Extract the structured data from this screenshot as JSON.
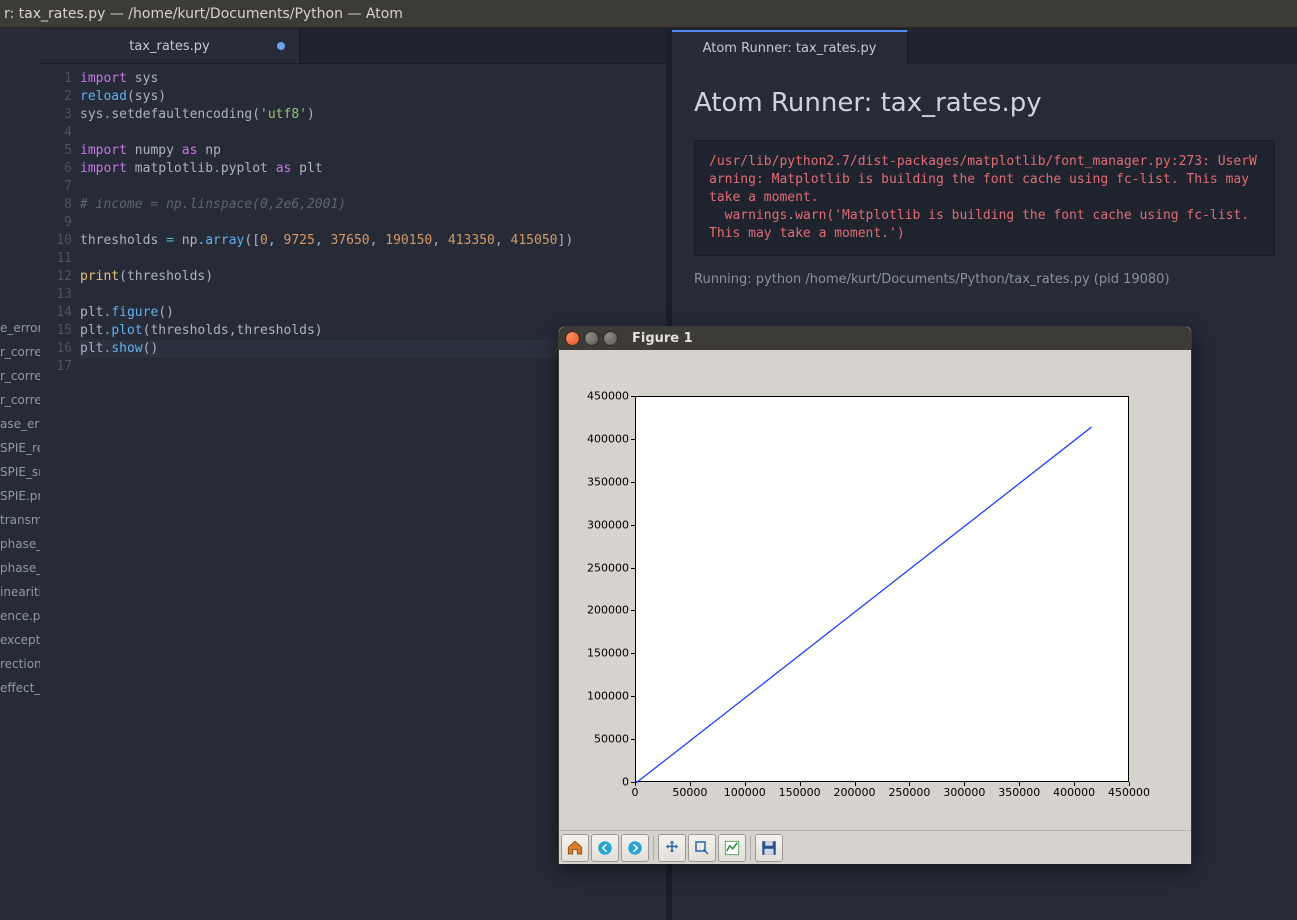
{
  "window_title": "r: tax_rates.py — /home/kurt/Documents/Python — Atom",
  "editor": {
    "tab_label": "tax_rates.py",
    "line_count": 17,
    "code_tokens": [
      [
        [
          "kw",
          "import"
        ],
        [
          "id",
          " sys"
        ]
      ],
      [
        [
          "fn",
          "reload"
        ],
        [
          "id",
          "(sys)"
        ]
      ],
      [
        [
          "id",
          "sys"
        ],
        [
          "op",
          "."
        ],
        [
          "id",
          "setdefaultencoding("
        ],
        [
          "str",
          "'utf8'"
        ],
        [
          "id",
          ")"
        ]
      ],
      [],
      [
        [
          "kw",
          "import"
        ],
        [
          "id",
          " numpy "
        ],
        [
          "kw",
          "as"
        ],
        [
          "id",
          " np"
        ]
      ],
      [
        [
          "kw",
          "import"
        ],
        [
          "id",
          " matplotlib"
        ],
        [
          "op",
          "."
        ],
        [
          "id",
          "pyplot "
        ],
        [
          "kw",
          "as"
        ],
        [
          "id",
          " plt"
        ]
      ],
      [],
      [
        [
          "cmt",
          "# income = np.linspace(0,2e6,2001)"
        ]
      ],
      [],
      [
        [
          "id",
          "thresholds "
        ],
        [
          "op",
          "="
        ],
        [
          "id",
          " np"
        ],
        [
          "op",
          "."
        ],
        [
          "fn",
          "array"
        ],
        [
          "id",
          "(["
        ],
        [
          "num",
          "0"
        ],
        [
          "id",
          ", "
        ],
        [
          "num",
          "9725"
        ],
        [
          "id",
          ", "
        ],
        [
          "num",
          "37650"
        ],
        [
          "id",
          ", "
        ],
        [
          "num",
          "190150"
        ],
        [
          "id",
          ", "
        ],
        [
          "num",
          "413350"
        ],
        [
          "id",
          ", "
        ],
        [
          "num",
          "415050"
        ],
        [
          "id",
          "])"
        ]
      ],
      [],
      [
        [
          "bi",
          "print"
        ],
        [
          "id",
          "(thresholds)"
        ]
      ],
      [],
      [
        [
          "id",
          "plt"
        ],
        [
          "op",
          "."
        ],
        [
          "fn",
          "figure"
        ],
        [
          "id",
          "()"
        ]
      ],
      [
        [
          "id",
          "plt"
        ],
        [
          "op",
          "."
        ],
        [
          "fn",
          "plot"
        ],
        [
          "id",
          "(thresholds,thresholds)"
        ]
      ],
      [
        [
          "id",
          "plt"
        ],
        [
          "op",
          "."
        ],
        [
          "fn",
          "show"
        ],
        [
          "id",
          "()"
        ]
      ],
      []
    ],
    "highlight_line": 16
  },
  "tree_items": [
    "e_error:",
    "r_corre",
    "r_corre",
    "r_corre",
    "ase_err",
    "SPIE_re",
    "SPIE_sr",
    "SPIE.pr",
    "transm",
    "phase_",
    "phase_",
    "inearitie",
    "ence.py",
    "except",
    "rection_",
    "effect_"
  ],
  "runner": {
    "tab_label": "Atom Runner: tax_rates.py",
    "heading": "Atom Runner: tax_rates.py",
    "output": "/usr/lib/python2.7/dist-packages/matplotlib/font_manager.py:273: UserWarning: Matplotlib is building the font cache using fc-list. This may take a moment.\n  warnings.warn('Matplotlib is building the font cache using fc-list. This may take a moment.')",
    "status": "Running: python /home/kurt/Documents/Python/tax_rates.py (pid 19080)"
  },
  "figure": {
    "title": "Figure 1",
    "toolbar": [
      "home",
      "back",
      "forward",
      "pan",
      "zoom",
      "subplots",
      "save"
    ]
  },
  "chart_data": {
    "type": "line",
    "x": [
      0,
      9725,
      37650,
      190150,
      413350,
      415050
    ],
    "y": [
      0,
      9725,
      37650,
      190150,
      413350,
      415050
    ],
    "title": "",
    "xlabel": "",
    "ylabel": "",
    "xlim": [
      0,
      450000
    ],
    "ylim": [
      0,
      450000
    ],
    "xticks": [
      0,
      50000,
      100000,
      150000,
      200000,
      250000,
      300000,
      350000,
      400000,
      450000
    ],
    "yticks": [
      0,
      50000,
      100000,
      150000,
      200000,
      250000,
      300000,
      350000,
      400000,
      450000
    ],
    "line_color": "#1f3fff"
  }
}
